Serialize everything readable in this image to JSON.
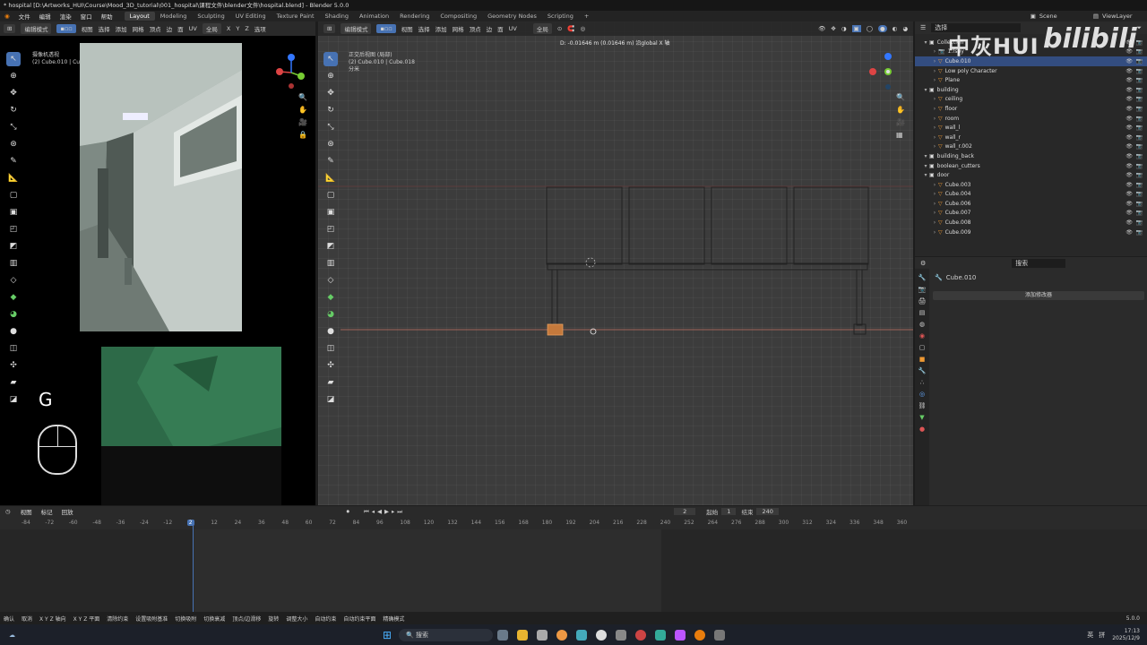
{
  "window": {
    "title": "* hospital [D:\\Artworks_HUI\\Course\\Mood_3D_tutorial\\001_hospital\\课程文件\\blender文件\\hospital.blend] - Blender 5.0.0"
  },
  "menus": [
    "文件",
    "编辑",
    "渲染",
    "窗口",
    "帮助"
  ],
  "workspaces": [
    "Layout",
    "Modeling",
    "Sculpting",
    "UV Editing",
    "Texture Paint",
    "Shading",
    "Animation",
    "Rendering",
    "Compositing",
    "Geometry Nodes",
    "Scripting"
  ],
  "active_workspace": "Layout",
  "scene_label": "Scene",
  "viewlayer_label": "ViewLayer",
  "watermark": {
    "text": "中灰HUI",
    "logo": "bilibili"
  },
  "left_viewport": {
    "mode": "编辑模式",
    "menus": [
      "视图",
      "选择",
      "添加",
      "网格",
      "顶点",
      "边",
      "面",
      "UV"
    ],
    "transform": "全局",
    "axes": [
      "X",
      "Y",
      "Z"
    ],
    "options": "选项",
    "view_name": "摄像机透视",
    "object_info": "(2) Cube.010 | Cube.018",
    "key_overlay": "G"
  },
  "main_viewport": {
    "mode": "编辑模式",
    "menus": [
      "视图",
      "选择",
      "添加",
      "网格",
      "顶点",
      "边",
      "面",
      "UV"
    ],
    "transform": "全局",
    "view_name": "正交后视图 (局部)",
    "object_info": "(2) Cube.010 | Cube.018",
    "units": "分米",
    "move_info": "D: -0.01646 m (0.01646 m) 沿global X 轴"
  },
  "outliner": {
    "search_placeholder": "选择",
    "items": [
      {
        "name": "Collection",
        "depth": 0,
        "type": "collection",
        "hl": false
      },
      {
        "name": "1.fspy",
        "depth": 1,
        "type": "camera",
        "hl": false
      },
      {
        "name": "Cube.010",
        "depth": 1,
        "type": "mesh",
        "hl": true
      },
      {
        "name": "Low poly Character",
        "depth": 1,
        "type": "mesh",
        "hl": false
      },
      {
        "name": "Plane",
        "depth": 1,
        "type": "mesh",
        "hl": false
      },
      {
        "name": "building",
        "depth": 0,
        "type": "collection",
        "hl": false
      },
      {
        "name": "ceiling",
        "depth": 1,
        "type": "mesh",
        "hl": false
      },
      {
        "name": "floor",
        "depth": 1,
        "type": "mesh",
        "hl": false
      },
      {
        "name": "room",
        "depth": 1,
        "type": "mesh",
        "hl": false
      },
      {
        "name": "wall_l",
        "depth": 1,
        "type": "mesh",
        "hl": false
      },
      {
        "name": "wall_r",
        "depth": 1,
        "type": "mesh",
        "hl": false
      },
      {
        "name": "wall_r.002",
        "depth": 1,
        "type": "mesh",
        "hl": false
      },
      {
        "name": "building_back",
        "depth": 0,
        "type": "collection",
        "hl": false
      },
      {
        "name": "boolean_cutters",
        "depth": 0,
        "type": "collection",
        "hl": false
      },
      {
        "name": "door",
        "depth": 0,
        "type": "collection",
        "hl": false
      },
      {
        "name": "Cube.003",
        "depth": 1,
        "type": "mesh",
        "hl": false
      },
      {
        "name": "Cube.004",
        "depth": 1,
        "type": "mesh",
        "hl": false
      },
      {
        "name": "Cube.006",
        "depth": 1,
        "type": "mesh",
        "hl": false
      },
      {
        "name": "Cube.007",
        "depth": 1,
        "type": "mesh",
        "hl": false
      },
      {
        "name": "Cube.008",
        "depth": 1,
        "type": "mesh",
        "hl": false
      },
      {
        "name": "Cube.009",
        "depth": 1,
        "type": "mesh",
        "hl": false
      }
    ]
  },
  "properties": {
    "search_placeholder": "搜索",
    "object_name": "Cube.010",
    "add_modifier": "添加修改器"
  },
  "timeline": {
    "menus": [
      "视图",
      "标记",
      "回放"
    ],
    "current_frame": "2",
    "start_label": "起始",
    "start": "1",
    "end_label": "结束",
    "end": "240",
    "ticks": [
      "-84",
      "-72",
      "-60",
      "-48",
      "-36",
      "-24",
      "-12",
      "2",
      "12",
      "24",
      "36",
      "48",
      "60",
      "72",
      "84",
      "96",
      "108",
      "120",
      "132",
      "144",
      "156",
      "168",
      "180",
      "192",
      "204",
      "216",
      "228",
      "240",
      "252",
      "264",
      "276",
      "288",
      "300",
      "312",
      "324",
      "336",
      "348",
      "360"
    ]
  },
  "statusbar": {
    "items": [
      "确认",
      "取消",
      "X Y Z 轴向",
      "X Y Z 平面",
      "清除约束",
      "设置吸附基准",
      "切换吸附",
      "切换衰减",
      "顶点/边滑移",
      "旋转",
      "调整大小",
      "自动约束",
      "自动约束平面",
      "精确模式"
    ],
    "version": "5.0.0"
  },
  "taskbar": {
    "search": "搜索",
    "lang": "英",
    "ime": "拼",
    "time": "17:13",
    "date": "2025/12/9"
  }
}
